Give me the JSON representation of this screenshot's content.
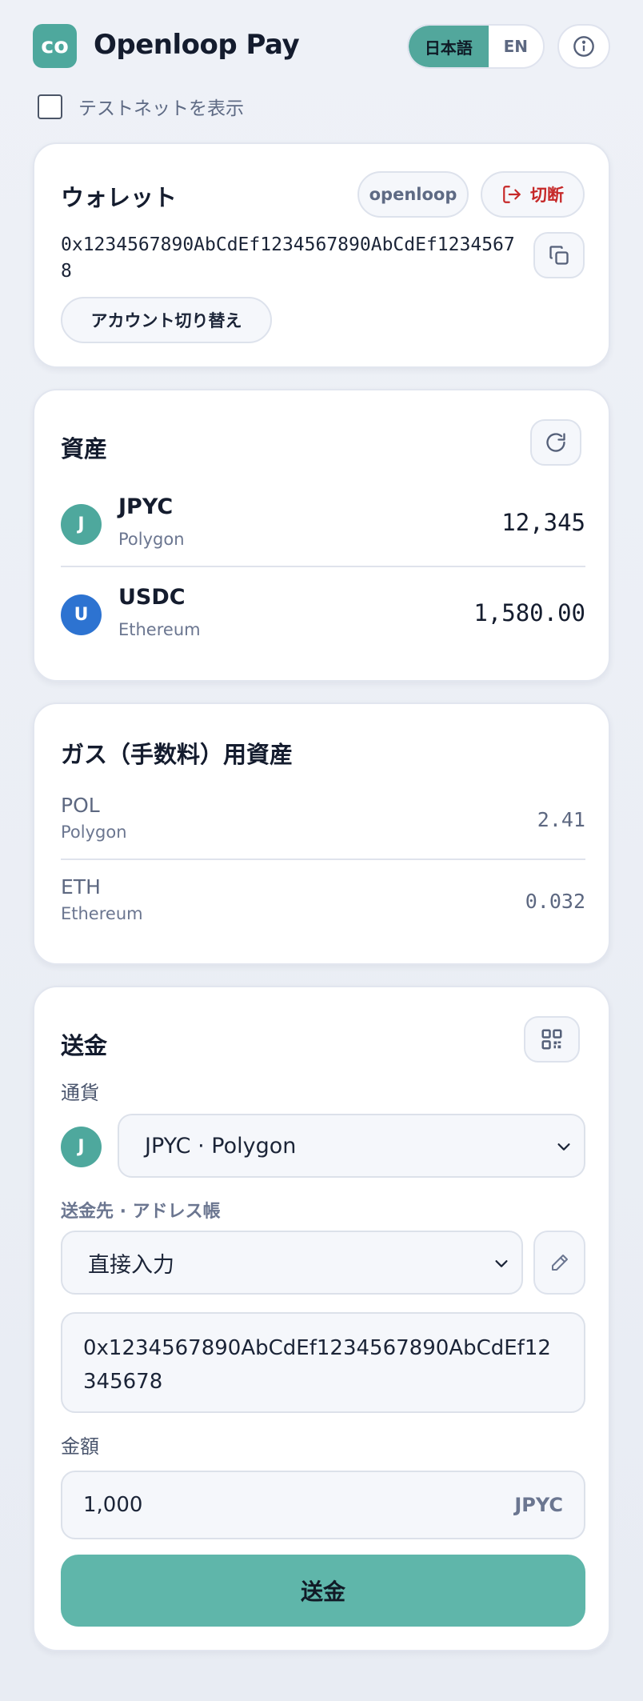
{
  "app": {
    "logo_text": "co",
    "title": "Openloop Pay"
  },
  "lang": {
    "ja": "日本語",
    "en": "EN",
    "active": "ja"
  },
  "testnet": {
    "label": "テストネットを表示",
    "checked": false
  },
  "wallet": {
    "title": "ウォレット",
    "connector": "openloop",
    "disconnect_label": "切断",
    "address": "0x1234567890AbCdEf1234567890AbCdEf12345678",
    "switch_account_label": "アカウント切り替え"
  },
  "assets": {
    "title": "資産",
    "items": [
      {
        "symbol": "JPYC",
        "initial": "J",
        "network": "Polygon",
        "balance": "12,345",
        "color": "#4ea89d"
      },
      {
        "symbol": "USDC",
        "initial": "U",
        "network": "Ethereum",
        "balance": "1,580.00",
        "color": "#2d73d1"
      }
    ]
  },
  "gas": {
    "title": "ガス（手数料）用資産",
    "items": [
      {
        "symbol": "POL",
        "network": "Polygon",
        "balance": "2.41"
      },
      {
        "symbol": "ETH",
        "network": "Ethereum",
        "balance": "0.032"
      }
    ]
  },
  "send": {
    "title": "送金",
    "currency_label": "通貨",
    "currency_initial": "J",
    "currency_value": "JPYC · Polygon",
    "recipient_label": "送金先 · アドレス帳",
    "recipient_mode": "直接入力",
    "recipient_address": "0x1234567890AbCdEf1234567890AbCdEf12345678",
    "amount_label": "金額",
    "amount_value": "1,000",
    "amount_unit": "JPYC",
    "submit_label": "送金"
  },
  "colors": {
    "accent": "#4ea89d",
    "accent_button": "#5fb6aa",
    "danger": "#c62828",
    "usdc": "#2d73d1"
  },
  "icons": [
    "info-icon",
    "logout-icon",
    "copy-icon",
    "refresh-icon",
    "qr-code-icon",
    "chevron-down-icon",
    "pencil-icon"
  ]
}
